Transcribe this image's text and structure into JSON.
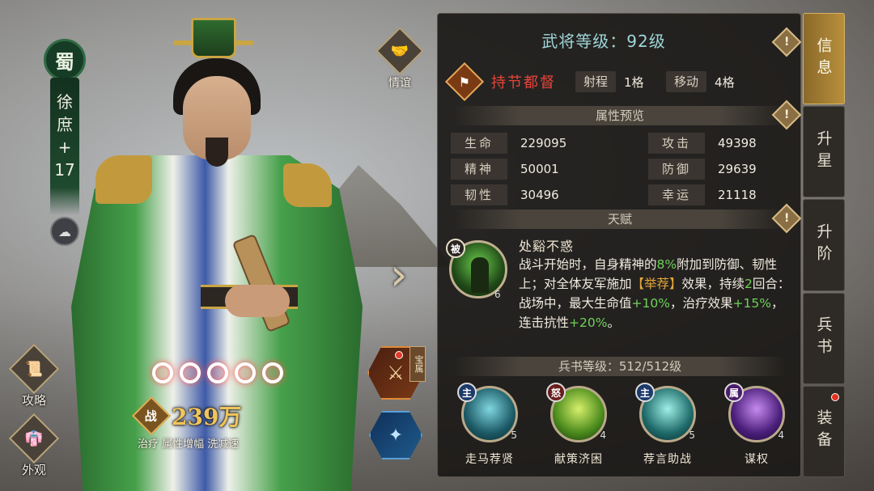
{
  "hero": {
    "faction": "蜀",
    "name_chars": [
      "徐",
      "庶",
      "+",
      "17"
    ]
  },
  "left_menu": {
    "strategy_label": "攻略",
    "appearance_label": "外观"
  },
  "friendship_label": "情谊",
  "power": {
    "icon_label": "战",
    "value": "239万",
    "tags": "治疗 属性增幅 洗减速"
  },
  "equip": {
    "tag": "宝属"
  },
  "panel": {
    "level_title": "武将等级：92级",
    "role_name": "持节都督",
    "range_label": "射程",
    "range_value": "1格",
    "move_label": "移动",
    "move_value": "4格",
    "attr_section": "属性预览",
    "attributes": [
      {
        "label": "生命",
        "value": "229095"
      },
      {
        "label": "攻击",
        "value": "49398"
      },
      {
        "label": "精神",
        "value": "50001"
      },
      {
        "label": "防御",
        "value": "29639"
      },
      {
        "label": "韧性",
        "value": "30496"
      },
      {
        "label": "幸运",
        "value": "21118"
      }
    ],
    "talent_section": "天赋",
    "talent": {
      "badge": "被",
      "level": "6",
      "name": "处谿不惑",
      "desc_1": "战斗开始时，自身精神的",
      "pct_1": "8%",
      "desc_2": "附加到防御、韧性上；对全体友军施加",
      "buff": "【举荐】",
      "desc_3": "效果，持续",
      "rounds": "2",
      "desc_4": "回合：战场中，最大生命值",
      "pct_2": "+10%",
      "desc_5": "，治疗效果",
      "pct_3": "+15%",
      "desc_6": "，连击抗性",
      "pct_4": "+20%",
      "desc_7": "。"
    },
    "book_section": "兵书等级：512/512级",
    "skills": [
      {
        "tag": "主",
        "level": "5",
        "name": "走马荐贤"
      },
      {
        "tag": "怒",
        "level": "4",
        "name": "献策济困"
      },
      {
        "tag": "主",
        "level": "5",
        "name": "荐言助战"
      },
      {
        "tag": "属",
        "level": "4",
        "name": "谋权"
      }
    ]
  },
  "tabs": [
    {
      "label": "信息"
    },
    {
      "label": "升星"
    },
    {
      "label": "升阶"
    },
    {
      "label": "兵书"
    },
    {
      "label": "装备"
    }
  ],
  "colors": {
    "role_red": "#e8443a",
    "level_cyan": "#9fd6d8",
    "green_highlight": "#6fd25a",
    "power_gold": "#f0c45a",
    "tab_active": "#b88f3c"
  }
}
